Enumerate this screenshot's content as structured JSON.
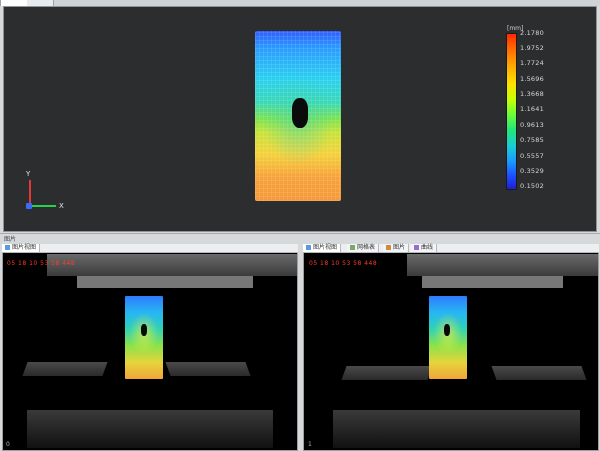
{
  "viewport": {
    "unit_label": "[mm]",
    "scale_labels": [
      "2.1780",
      "1.9752",
      "1.7724",
      "1.5696",
      "1.3668",
      "1.1641",
      "0.9613",
      "0.7585",
      "0.5557",
      "0.3529",
      "0.1502"
    ],
    "axes": {
      "y_label": "Y",
      "x_label": "X"
    }
  },
  "bottom": {
    "bar_label": "图片",
    "left_panel": {
      "tab_label": "图片视图",
      "timestamp": "05 18 10 53 58 448",
      "page_number": "0"
    },
    "right_panel": {
      "tabs": [
        "图片视图",
        "网格表",
        "图片",
        "曲线"
      ],
      "timestamp": "05 18 10 53 58 448",
      "page_number": "1"
    }
  }
}
